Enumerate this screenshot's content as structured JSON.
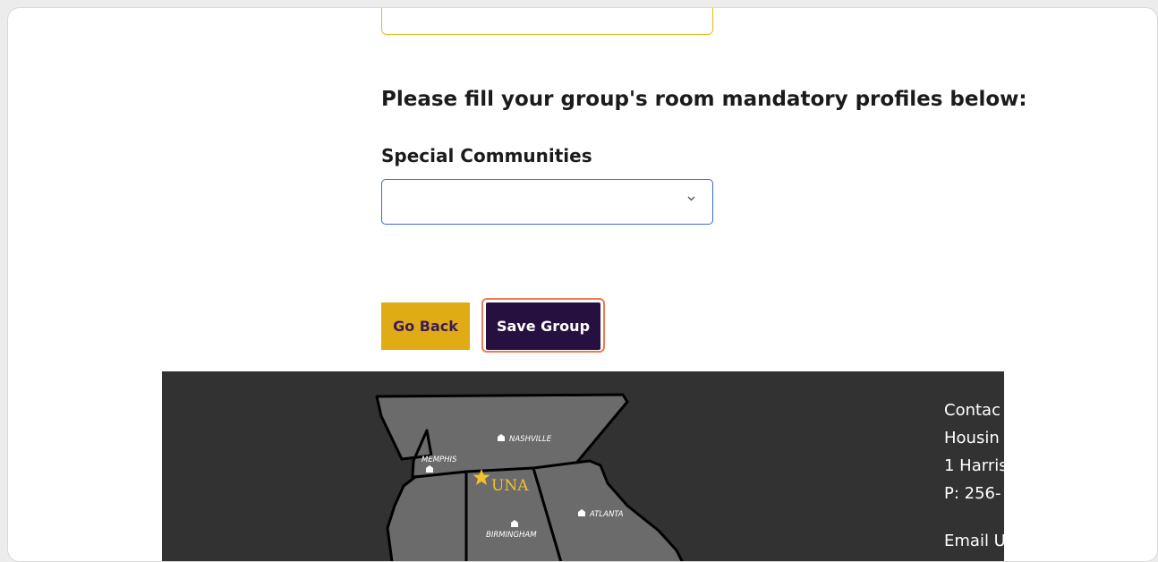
{
  "form": {
    "heading": "Please fill your group's room mandatory profiles below:",
    "special_communities": {
      "label": "Special Communities",
      "value": ""
    }
  },
  "buttons": {
    "go_back": "Go Back",
    "save_group": "Save Group"
  },
  "footer": {
    "map": {
      "cities": [
        "NASHVILLE",
        "MEMPHIS",
        "ATLANTA",
        "BIRMINGHAM"
      ],
      "marker": "UNA"
    },
    "contact_lines": [
      "Contac",
      "Housin",
      "1 Harris",
      "P: 256-",
      "Email U"
    ]
  },
  "colors": {
    "gold": "#e0ab14",
    "purple": "#26103f",
    "focus_ring": "#ee7a52",
    "select_border": "#3a6ad6",
    "footer_bg": "#323232"
  }
}
